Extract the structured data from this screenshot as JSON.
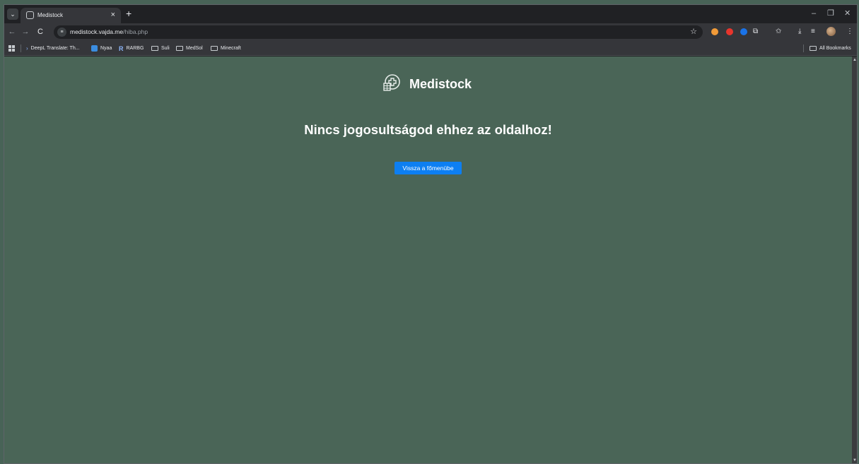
{
  "browser": {
    "tab": {
      "title": "Medistock",
      "close": "×"
    },
    "new_tab": "+",
    "window_controls": {
      "minimize": "–",
      "restore": "❐",
      "close": "✕"
    },
    "nav": {
      "back": "←",
      "forward": "→",
      "reload": "C"
    },
    "address": {
      "host": "medistock.vajda.me",
      "path": "/hiba.php"
    },
    "bookmarks": [
      {
        "label": "DeepL Translate: Th...",
        "icon": "deepl-icon"
      },
      {
        "label": "Nyaa",
        "icon": "nyaa-icon"
      },
      {
        "label": "RARBG",
        "icon": "rarbg-icon"
      },
      {
        "label": "Suli",
        "icon": "folder-icon"
      },
      {
        "label": "MedSol",
        "icon": "folder-icon"
      },
      {
        "label": "Minecraft",
        "icon": "folder-icon"
      }
    ],
    "all_bookmarks": "All Bookmarks"
  },
  "page": {
    "brand": "Medistock",
    "heading": "Nincs jogosultságod ehhez az oldalhoz!",
    "back_button": "Vissza a főmenübe"
  },
  "colors": {
    "page_background": "#4a6557",
    "button": "#0d7ff2"
  }
}
